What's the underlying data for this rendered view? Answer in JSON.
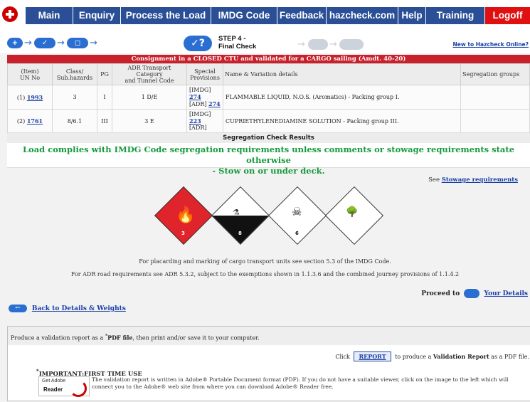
{
  "nav": {
    "items": [
      "Main",
      "Enquiry",
      "Process the Load",
      "IMDG Code",
      "Feedback",
      "hazcheck.com",
      "Help",
      "Training",
      "Logoff"
    ]
  },
  "progress": {
    "step_line1": "STEP 4 -",
    "step_line2": "Final Check",
    "check_mark": "✓?",
    "new_link": "New to Hazcheck Online?"
  },
  "consignment": {
    "banner": "Consignment in a CLOSED CTU and validated for a CARGO sailing (Amdt. 40-20)",
    "headers": {
      "un_a": "(Item)",
      "un_b": "UN No",
      "cls_a": "Class/",
      "cls_b": "Sub.hazards",
      "pg": "PG",
      "adr_a": "ADR Transport Category",
      "adr_b": "and Tunnel Code",
      "sp_a": "Special",
      "sp_b": "Provisions",
      "name": "Name & Variation details",
      "seg": "Segregation groups"
    },
    "rows": [
      {
        "item": "(1)",
        "un": "1993",
        "cls": "3",
        "pg": "I",
        "adr": "1  D/E",
        "sp1_tag": "[IMDG]",
        "sp1_num": "274",
        "sp2_tag": "[ADR]",
        "sp2_num": "274",
        "name": "FLAMMABLE LIQUID, N.O.S. (Aromatics) - Packing group I.",
        "seg": ""
      },
      {
        "item": "(2)",
        "un": "1761",
        "cls": "8/6.1",
        "pg": "III",
        "adr": "3  E",
        "sp1_tag": "[IMDG]",
        "sp1_num": "223",
        "sp2_tag": "[ADR]",
        "sp2_num": "",
        "name": "CUPRIETHYLENEDIAMINE SOLUTION - Packing group III.",
        "seg": ""
      }
    ]
  },
  "segregation": {
    "heading": "Segregation Check Results",
    "message_line1": "Load complies with IMDG Code segregation requirements unless comments or stowage requirements state otherwise",
    "message_line2": "- Stow on or under deck."
  },
  "stowage": {
    "see": "See",
    "link": "Stowage requirements"
  },
  "placards": {
    "labels": [
      "3",
      "8",
      "6",
      ""
    ],
    "colors": {
      "flammable": "#e0242b",
      "corrosive_bottom": "#111111",
      "toxic": "#ffffff"
    }
  },
  "notes": {
    "line1": "For placarding and marking of cargo transport units see section 5.3 of the IMDG Code.",
    "line2": "For ADR road requirements see ADR 5.3.2, subject to the exemptions shown in 1.1.3.6 and the combined journey provisions of 1.1.4.2"
  },
  "proceed": {
    "label": "Proceed to",
    "link": "Your Details"
  },
  "back": {
    "link": "Back to Details & Weights"
  },
  "report": {
    "intro_a": "Produce a validation report as a",
    "intro_b": "PDF file",
    "intro_c": ", then print and/or save it to your computer.",
    "click_a": "Click",
    "button": "REPORT",
    "click_b": "to produce a",
    "click_c": "Validation Report",
    "click_d": "as a PDF file.",
    "important": "IMPORTANT:FIRST TIME USE",
    "adobe_line1": "Get Adobe",
    "adobe_line2": "Reader",
    "important_text": "The validation report is written in Adobe® Portable Document format (PDF). If you do not have a suitable viewer, click on the image to the left which will connect you to the Adobe® web site from where you can download Adobe® Reader free."
  }
}
